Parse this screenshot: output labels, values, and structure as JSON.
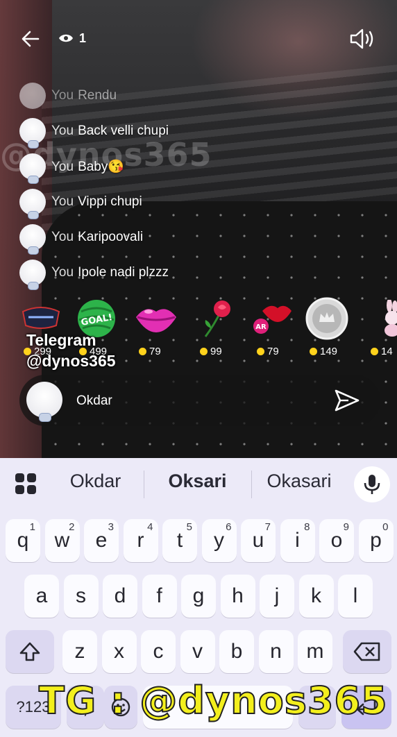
{
  "stream": {
    "viewer_count": "1",
    "watermark": "@dynos365"
  },
  "comments": [
    {
      "user": "You",
      "text": "Rendu"
    },
    {
      "user": "You",
      "text": "Back velli chupi"
    },
    {
      "user": "You",
      "text": "Baby😘"
    },
    {
      "user": "You",
      "text": "Vippi chupi"
    },
    {
      "user": "You",
      "text": "Karipoovali"
    },
    {
      "user": "You",
      "text": "Ipole nadi plzzz"
    }
  ],
  "gifts": [
    {
      "name": "crown-gift",
      "price": "299"
    },
    {
      "name": "goal-gift",
      "price": "499",
      "label": "GOAL!"
    },
    {
      "name": "lips-gift",
      "price": "79"
    },
    {
      "name": "rose-gift",
      "price": "99"
    },
    {
      "name": "ar-lips-gift",
      "price": "79",
      "label": "AR"
    },
    {
      "name": "silver-crown-gift",
      "price": "149"
    },
    {
      "name": "bunny-gift",
      "price": "14"
    }
  ],
  "overlay": {
    "line1": "Telegram",
    "line2": "@dynos365",
    "bottom": "TG : @dynos365"
  },
  "input": {
    "value": "Okdar"
  },
  "keyboard": {
    "suggestions": [
      "Okdar",
      "Oksari",
      "Okasari"
    ],
    "row1": [
      {
        "k": "q",
        "h": "1"
      },
      {
        "k": "w",
        "h": "2"
      },
      {
        "k": "e",
        "h": "3"
      },
      {
        "k": "r",
        "h": "4"
      },
      {
        "k": "t",
        "h": "5"
      },
      {
        "k": "y",
        "h": "6"
      },
      {
        "k": "u",
        "h": "7"
      },
      {
        "k": "i",
        "h": "8"
      },
      {
        "k": "o",
        "h": "9"
      },
      {
        "k": "p",
        "h": "0"
      }
    ],
    "row2": [
      "a",
      "s",
      "d",
      "f",
      "g",
      "h",
      "j",
      "k",
      "l"
    ],
    "row3": [
      "z",
      "x",
      "c",
      "v",
      "b",
      "n",
      "m"
    ],
    "symbols_key": "?123",
    "comma_key": ","
  },
  "colors": {
    "keyboard_bg": "#eceaf8",
    "key_bg": "#fbfbff",
    "mod_key_bg": "#dcd8f1",
    "coin": "#ffd21c",
    "tg_text": "#f3ef1d"
  }
}
